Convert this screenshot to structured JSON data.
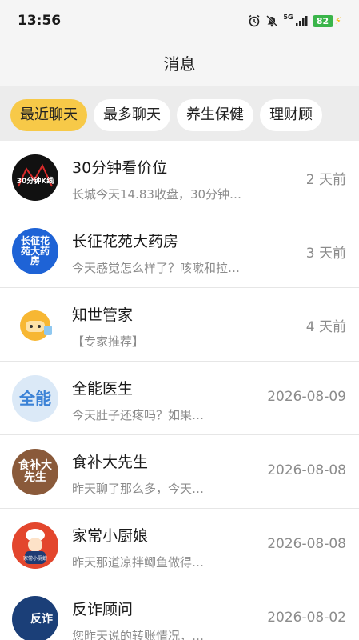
{
  "status_bar": {
    "time": "13:56",
    "network": "5G",
    "battery": "82"
  },
  "header": {
    "title": "消息"
  },
  "tabs": [
    {
      "label": "最近聊天",
      "active": true
    },
    {
      "label": "最多聊天",
      "active": false
    },
    {
      "label": "养生保健",
      "active": false
    },
    {
      "label": "理财顾",
      "active": false
    }
  ],
  "chats": [
    {
      "name": "30分钟看价位",
      "preview": "长城今天14.83收盘，30分钟…",
      "time": "2 天前",
      "avatar_text": "30分钟K线"
    },
    {
      "name": "长征花苑大药房",
      "preview": "今天感觉怎么样了？咳嗽和拉…",
      "time": "3 天前",
      "avatar_text": "长征花苑大药房"
    },
    {
      "name": "知世管家",
      "preview": "【专家推荐】",
      "time": "4 天前",
      "avatar_text": ""
    },
    {
      "name": "全能医生",
      "preview": "今天肚子还疼吗？如果…",
      "time": "2026-08-09",
      "avatar_text": "全能"
    },
    {
      "name": "食补大先生",
      "preview": "昨天聊了那么多，今天…",
      "time": "2026-08-08",
      "avatar_text": "食补大先生"
    },
    {
      "name": "家常小厨娘",
      "preview": "昨天那道凉拌鲫鱼做得…",
      "time": "2026-08-08",
      "avatar_text": "家常小厨娘"
    },
    {
      "name": "反诈顾问",
      "preview": "您昨天说的转账情况，…",
      "time": "2026-08-02",
      "avatar_text": "反诈"
    }
  ]
}
